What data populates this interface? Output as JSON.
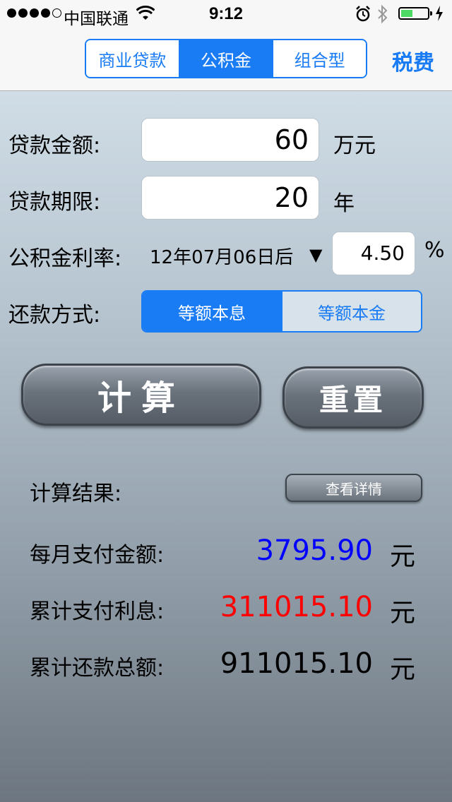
{
  "status": {
    "carrier": "中国联通",
    "time": "9:12"
  },
  "nav": {
    "tabs": [
      "商业贷款",
      "公积金",
      "组合型"
    ],
    "active_tab": 1,
    "tax_button": "税费"
  },
  "form": {
    "amount_label": "贷款金额:",
    "amount_value": "60",
    "amount_unit": "万元",
    "term_label": "贷款期限:",
    "term_value": "20",
    "term_unit": "年",
    "rate_label": "公积金利率:",
    "rate_date": "12年07月06日后",
    "rate_value": "4.50",
    "rate_unit": "%",
    "method_label": "还款方式:",
    "methods": [
      "等额本息",
      "等额本金"
    ]
  },
  "buttons": {
    "calculate": "计算",
    "reset": "重置",
    "details": "查看详情"
  },
  "results": {
    "title": "计算结果:",
    "monthly_label": "每月支付金额:",
    "monthly_value": "3795.90",
    "interest_label": "累计支付利息:",
    "interest_value": "311015.10",
    "total_label": "累计还款总额:",
    "total_value": "911015.10",
    "unit": "元"
  },
  "colors": {
    "accent": "#1a7cf5",
    "monthly": "#0000ff",
    "interest": "#ff0000",
    "total": "#000000"
  }
}
